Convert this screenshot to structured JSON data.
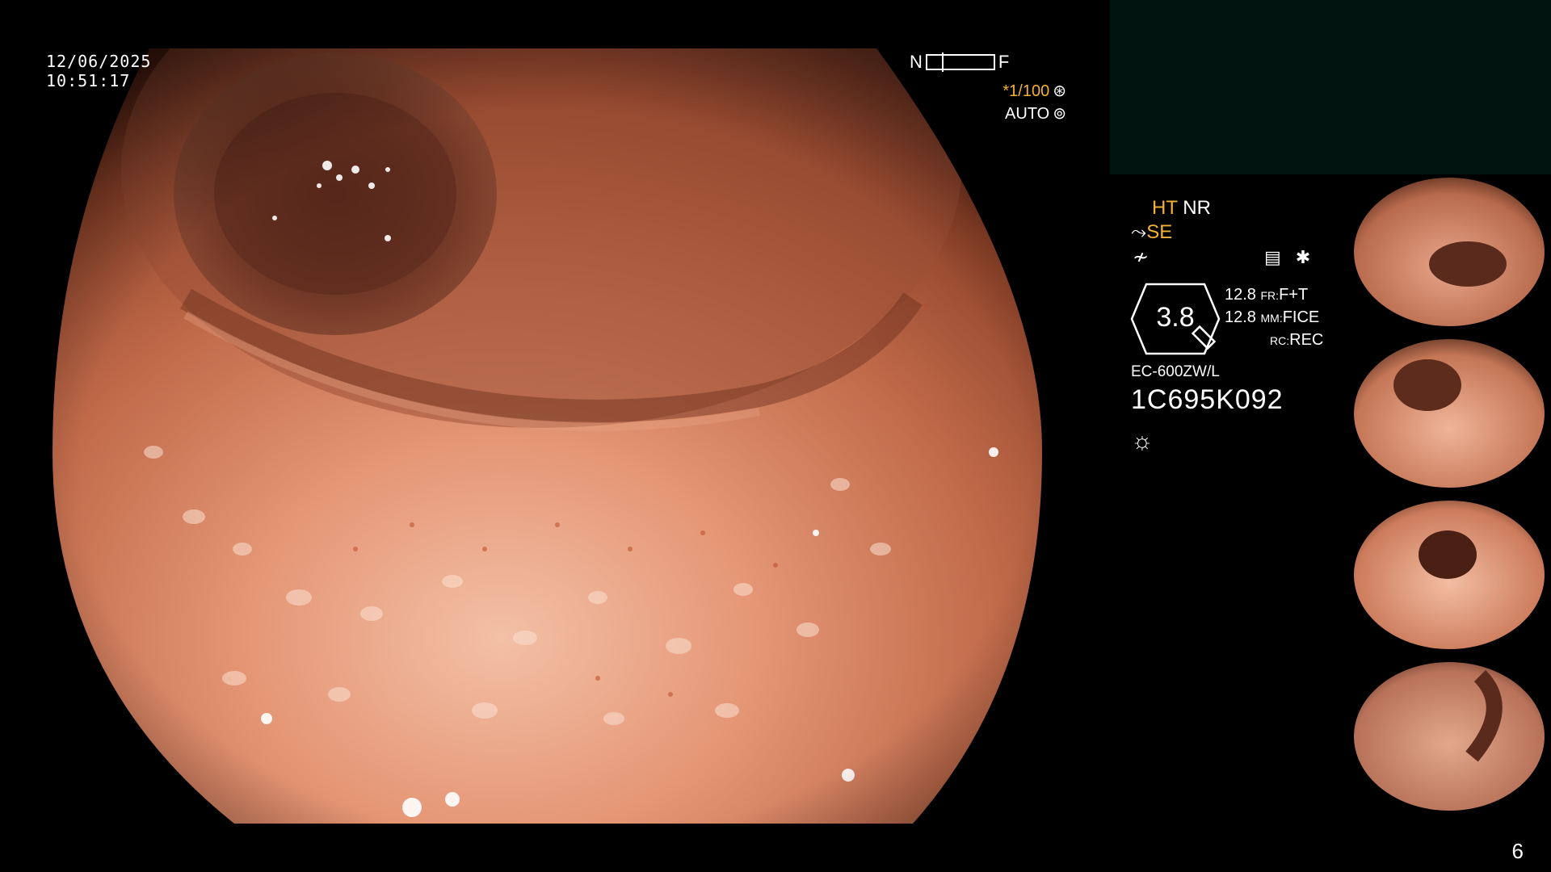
{
  "overlay": {
    "date": "12/06/2025",
    "time": "10:51:17",
    "nf_near": "N",
    "nf_far": "F",
    "shutter": "*1/100",
    "iris": "AUTO"
  },
  "settings": {
    "ht": "HT",
    "nr": "NR",
    "se": "SE",
    "zoom": "3.8",
    "value_1": "12.8",
    "value_2": "12.8",
    "fr_label": "FR:",
    "fr_value": "F+T",
    "mm_label": "MM:",
    "mm_value": "FICE",
    "rc_label": "RC:",
    "rc_value": "REC",
    "model": "EC-600ZW/L",
    "serial": "1C695K092"
  },
  "icons": {
    "shutter": "shutter-icon",
    "iris": "iris-icon",
    "structure": "structure-enhance-icon",
    "tilde": "tone-icon",
    "memo": "memo-icon",
    "asterisk": "asterisk-icon",
    "light": "light-icon"
  },
  "page": {
    "number": "6"
  },
  "colors": {
    "accent": "#f2b233",
    "background": "#000000",
    "panel": "#021410"
  }
}
